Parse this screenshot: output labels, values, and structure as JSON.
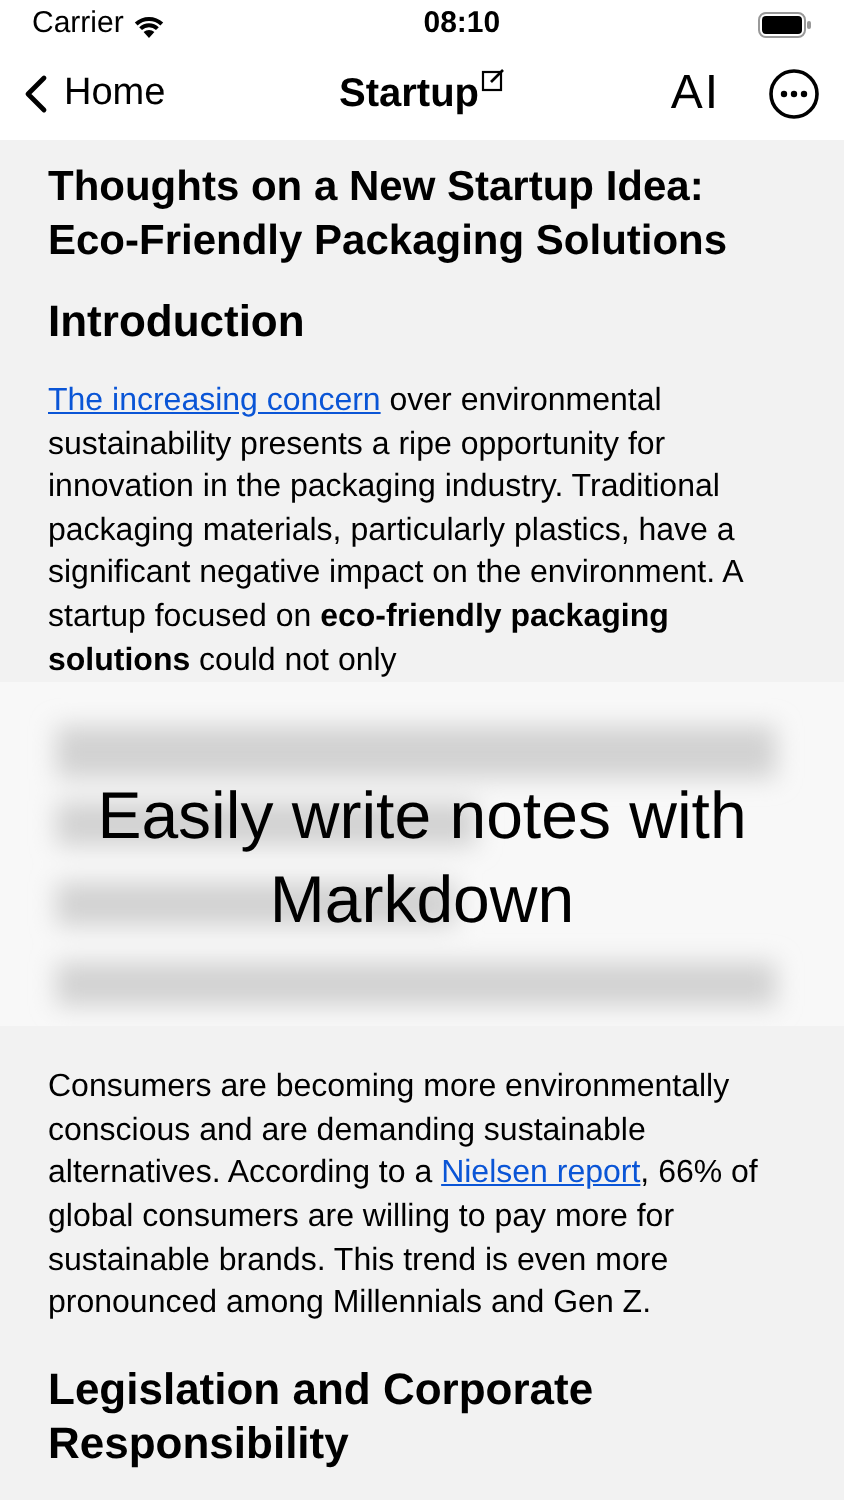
{
  "status_bar": {
    "carrier": "Carrier",
    "time": "08:10"
  },
  "nav": {
    "back": "Home",
    "title": "Startup",
    "format_button": "AI"
  },
  "document": {
    "title": "Thoughts on a New Startup Idea: Eco-Friendly Packaging Solutions",
    "blocks": [
      {
        "kind": "heading",
        "text": "Introduction"
      },
      {
        "kind": "paragraph",
        "parts": [
          {
            "kind": "link",
            "text": "The increasing concern"
          },
          {
            "kind": "text",
            "text": " over environmental sustainability presents a ripe opportunity for innovation in the packaging industry. Traditional packaging materials, particularly plastics, have a significant negative impact on the environment. A startup focused on **eco-friendly packaging solutions** could not only"
          }
        ]
      },
      {
        "kind": "banner",
        "text": "Easily write notes with Markdown"
      },
      {
        "kind": "paragraph",
        "parts": [
          {
            "kind": "text",
            "text": "Consumers are becoming more environmentally conscious and are demanding sustainable alternatives. According to a "
          },
          {
            "kind": "link",
            "text": "Nielsen report"
          },
          {
            "kind": "text",
            "text": ", 66% of global consumers are willing to pay more for sustainable brands. This trend is even more pronounced among Millennials and Gen Z."
          }
        ]
      },
      {
        "kind": "heading",
        "text": "Legislation and Corporate Responsibility"
      }
    ]
  }
}
